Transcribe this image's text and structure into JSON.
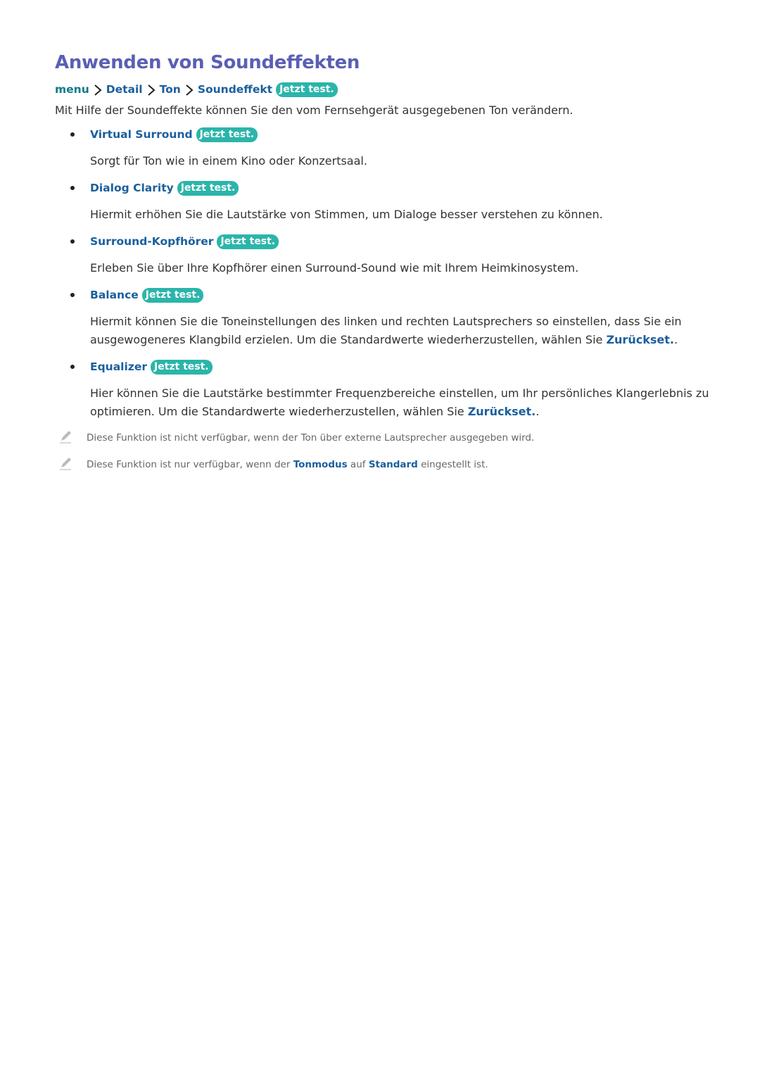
{
  "title": "Anwenden von Soundeffekten",
  "breadcrumb": {
    "items": [
      "menu",
      "Detail",
      "Ton",
      "Soundeffekt"
    ],
    "badge": "Jetzt test."
  },
  "intro": "Mit Hilfe der Soundeffekte können Sie den vom Fernsehgerät ausgegebenen Ton verändern.",
  "items": [
    {
      "title": "Virtual Surround",
      "badge": "Jetzt test.",
      "desc": "Sorgt für Ton wie in einem Kino oder Konzertsaal."
    },
    {
      "title": "Dialog Clarity",
      "badge": "Jetzt test.",
      "desc": "Hiermit erhöhen Sie die Lautstärke von Stimmen, um Dialoge besser verstehen zu können."
    },
    {
      "title": "Surround-Kopfhörer",
      "badge": "Jetzt test.",
      "desc": "Erleben Sie über Ihre Kopfhörer einen Surround-Sound wie mit Ihrem Heimkinosystem."
    },
    {
      "title": "Balance",
      "badge": "Jetzt test.",
      "desc": "Hiermit können Sie die Toneinstellungen des linken und rechten Lautsprechers so einstellen, dass Sie ein ausgewogeneres Klangbild erzielen. Um die Standardwerte wiederherzustellen, wählen Sie ",
      "link": "Zurückset.",
      "tail": "."
    },
    {
      "title": "Equalizer",
      "badge": "Jetzt test.",
      "desc": "Hier können Sie die Lautstärke bestimmter Frequenzbereiche einstellen, um Ihr persönliches Klangerlebnis zu optimieren. Um die Standardwerte wiederherzustellen, wählen Sie ",
      "link": "Zurückset.",
      "tail": "."
    }
  ],
  "notes": [
    {
      "text": "Diese Funktion ist nicht verfügbar, wenn der Ton über externe Lautsprecher ausgegeben wird."
    },
    {
      "pre": "Diese Funktion ist nur verfügbar, wenn der ",
      "link1": "Tonmodus",
      "mid": " auf ",
      "link2": "Standard",
      "post": " eingestellt ist."
    }
  ],
  "icons": {
    "separator": "chevron-right-icon",
    "note": "pencil-icon"
  },
  "colors": {
    "heading": "#5a5fb5",
    "link": "#1a5f9e",
    "badge": "#2bb5aa"
  }
}
